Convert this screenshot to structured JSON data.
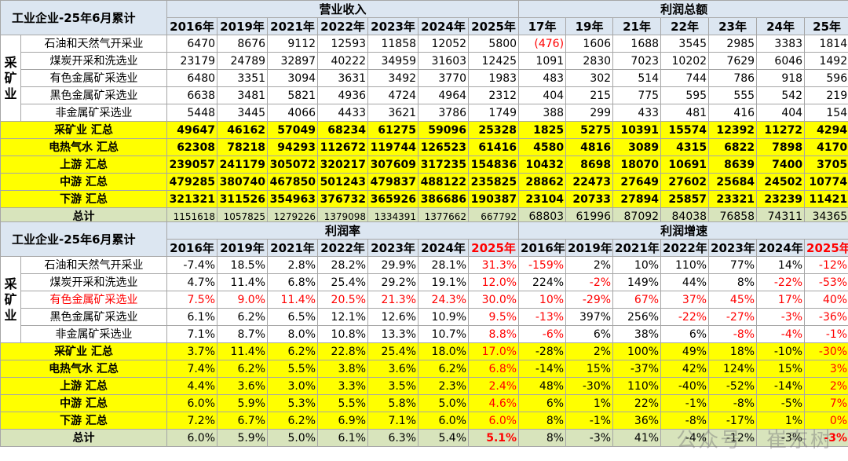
{
  "top": {
    "title": "工业企业-25年6月累计",
    "rev_header": "营业收入",
    "profit_header": "利润总额",
    "rev_years": [
      "2016年",
      "2019年",
      "2021年",
      "2022年",
      "2023年",
      "2024年",
      "2025年"
    ],
    "profit_years": [
      "17年",
      "19年",
      "21年",
      "22年",
      "23年",
      "24年",
      "25年"
    ],
    "group_label": "采矿业",
    "rows": [
      {
        "name": "石油和天然气开采业",
        "rev": [
          "6470",
          "8676",
          "9112",
          "12593",
          "11858",
          "12052",
          "5800"
        ],
        "profit": [
          "(476)",
          "1606",
          "1688",
          "3545",
          "2985",
          "3383",
          "1814"
        ]
      },
      {
        "name": "煤炭开采和洗选业",
        "rev": [
          "23179",
          "24789",
          "32897",
          "40222",
          "34959",
          "31603",
          "12425"
        ],
        "profit": [
          "1091",
          "2830",
          "7023",
          "10202",
          "7629",
          "6046",
          "1492"
        ]
      },
      {
        "name": "有色金属矿采选业",
        "rev": [
          "6480",
          "3351",
          "3094",
          "3631",
          "3492",
          "3770",
          "1983"
        ],
        "profit": [
          "483",
          "302",
          "514",
          "744",
          "786",
          "918",
          "596"
        ]
      },
      {
        "name": "黑色金属矿采选业",
        "rev": [
          "6638",
          "3481",
          "5821",
          "4936",
          "4724",
          "4964",
          "2312"
        ],
        "profit": [
          "404",
          "215",
          "775",
          "595",
          "555",
          "542",
          "219"
        ]
      },
      {
        "name": "非金属矿采选业",
        "rev": [
          "5448",
          "3445",
          "4066",
          "4433",
          "3621",
          "3786",
          "1749"
        ],
        "profit": [
          "388",
          "299",
          "433",
          "481",
          "416",
          "404",
          "154"
        ]
      }
    ],
    "sums": [
      {
        "name": "采矿业 汇总",
        "rev": [
          "49647",
          "46162",
          "57049",
          "68234",
          "61275",
          "59096",
          "25328"
        ],
        "profit": [
          "1825",
          "5275",
          "10391",
          "15574",
          "12392",
          "11272",
          "4294"
        ]
      },
      {
        "name": "电热气水 汇总",
        "rev": [
          "62308",
          "78218",
          "94293",
          "112672",
          "119744",
          "126523",
          "61416"
        ],
        "profit": [
          "4580",
          "4816",
          "3089",
          "4315",
          "6822",
          "7898",
          "4170"
        ]
      },
      {
        "name": "上游 汇总",
        "rev": [
          "239057",
          "241179",
          "305072",
          "320217",
          "307609",
          "317235",
          "154836"
        ],
        "profit": [
          "10432",
          "8698",
          "18070",
          "10691",
          "8639",
          "7400",
          "3705"
        ]
      },
      {
        "name": "中游 汇总",
        "rev": [
          "479285",
          "380740",
          "467850",
          "501243",
          "479837",
          "488122",
          "235825"
        ],
        "profit": [
          "28862",
          "22473",
          "27649",
          "27602",
          "25684",
          "24502",
          "10774"
        ]
      },
      {
        "name": "下游 汇总",
        "rev": [
          "321321",
          "311526",
          "354963",
          "376732",
          "365926",
          "386686",
          "190387"
        ],
        "profit": [
          "23104",
          "20733",
          "27894",
          "25857",
          "23321",
          "23239",
          "11421"
        ]
      }
    ],
    "total": {
      "name": "总计",
      "rev": [
        "1151618",
        "1057825",
        "1279226",
        "1379098",
        "1334391",
        "1377662",
        "667792"
      ],
      "profit": [
        "68803",
        "61996",
        "87092",
        "84038",
        "76858",
        "74311",
        "34365"
      ]
    }
  },
  "bottom": {
    "title": "工业企业-25年6月累计",
    "margin_header": "利润率",
    "growth_header": "利润增速",
    "years": [
      "2016年",
      "2019年",
      "2021年",
      "2022年",
      "2023年",
      "2024年",
      "2025年"
    ],
    "group_label": "采矿业",
    "rows": [
      {
        "name": "石油和天然气开采业",
        "margin": [
          "-7.4%",
          "18.5%",
          "2.8%",
          "28.2%",
          "29.9%",
          "28.1%",
          "31.3%"
        ],
        "growth": [
          "-159%",
          "2%",
          "10%",
          "110%",
          "77%",
          "14%",
          "-12%"
        ]
      },
      {
        "name": "煤炭开采和洗选业",
        "margin": [
          "4.7%",
          "11.4%",
          "6.8%",
          "25.4%",
          "29.2%",
          "19.1%",
          "12.0%"
        ],
        "growth": [
          "224%",
          "-2%",
          "149%",
          "44%",
          "8%",
          "-22%",
          "-53%"
        ]
      },
      {
        "name": "有色金属矿采选业",
        "margin": [
          "7.5%",
          "9.0%",
          "11.4%",
          "20.5%",
          "21.3%",
          "24.3%",
          "30.0%"
        ],
        "growth": [
          "10%",
          "-29%",
          "67%",
          "37%",
          "45%",
          "17%",
          "40%"
        ]
      },
      {
        "name": "黑色金属矿采选业",
        "margin": [
          "6.1%",
          "6.2%",
          "6.5%",
          "12.1%",
          "12.6%",
          "10.9%",
          "9.5%"
        ],
        "growth": [
          "-13%",
          "397%",
          "256%",
          "-22%",
          "-27%",
          "-3%",
          "-36%"
        ]
      },
      {
        "name": "非金属矿采选业",
        "margin": [
          "7.1%",
          "8.7%",
          "8.0%",
          "10.8%",
          "13.3%",
          "10.7%",
          "8.8%"
        ],
        "growth": [
          "-6%",
          "6%",
          "38%",
          "6%",
          "-8%",
          "-4%",
          "-1%"
        ]
      }
    ],
    "sums": [
      {
        "name": "采矿业 汇总",
        "margin": [
          "3.7%",
          "11.4%",
          "6.2%",
          "22.8%",
          "25.4%",
          "18.0%",
          "17.0%"
        ],
        "growth": [
          "-28%",
          "2%",
          "100%",
          "49%",
          "18%",
          "-10%",
          "-30%"
        ]
      },
      {
        "name": "电热气水 汇总",
        "margin": [
          "7.4%",
          "6.2%",
          "5.5%",
          "3.8%",
          "3.6%",
          "6.2%",
          "6.8%"
        ],
        "growth": [
          "-14%",
          "15%",
          "-37%",
          "42%",
          "124%",
          "15%",
          "3%"
        ]
      },
      {
        "name": "上游 汇总",
        "margin": [
          "4.4%",
          "3.6%",
          "3.0%",
          "3.3%",
          "3.5%",
          "2.3%",
          "2.4%"
        ],
        "growth": [
          "48%",
          "-30%",
          "110%",
          "-40%",
          "-52%",
          "-14%",
          "2%"
        ]
      },
      {
        "name": "中游 汇总",
        "margin": [
          "6.0%",
          "5.9%",
          "5.3%",
          "5.5%",
          "5.8%",
          "5.0%",
          "4.6%"
        ],
        "growth": [
          "6%",
          "1%",
          "22%",
          "-1%",
          "-8%",
          "-5%",
          "7%"
        ]
      },
      {
        "name": "下游 汇总",
        "margin": [
          "7.2%",
          "6.7%",
          "6.2%",
          "6.9%",
          "7.1%",
          "6.0%",
          "6.0%"
        ],
        "growth": [
          "8%",
          "-1%",
          "36%",
          "-8%",
          "-17%",
          "1%",
          "0%"
        ]
      }
    ],
    "total": {
      "name": "总计",
      "margin": [
        "6.0%",
        "5.9%",
        "5.0%",
        "6.1%",
        "6.3%",
        "5.4%",
        "5.1%"
      ],
      "growth": [
        "8%",
        "-3%",
        "41%",
        "-4%",
        "-12%",
        "-3%",
        "-3%"
      ]
    }
  },
  "watermark": "公众号 · 崔东树",
  "colors": {
    "header_bg": "#dce6f1",
    "sum_bg": "#ffff00",
    "total_bg": "#d8e4bc",
    "negative": "#ff0000"
  }
}
